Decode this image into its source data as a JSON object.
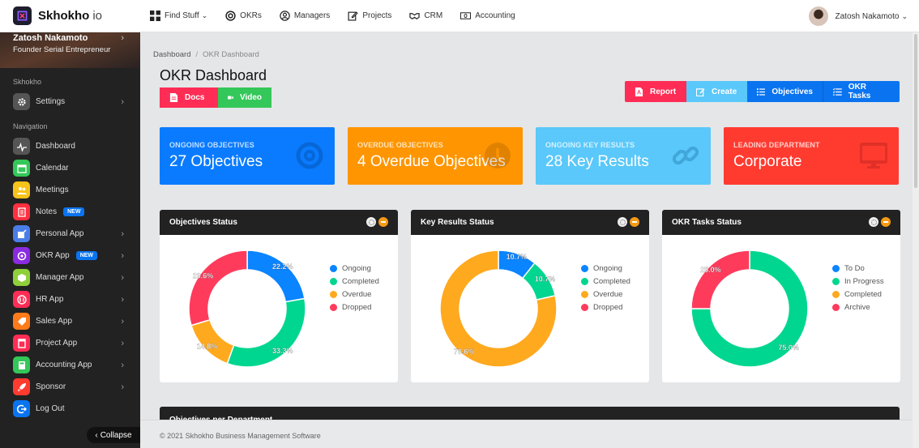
{
  "app": {
    "brand": "Skhokho",
    "brand_suffix": "io"
  },
  "topnav": [
    {
      "label": "Find Stuff",
      "icon": "grid-icon",
      "dropdown": true
    },
    {
      "label": "OKRs",
      "icon": "target-icon"
    },
    {
      "label": "Managers",
      "icon": "user-circle-icon"
    },
    {
      "label": "Projects",
      "icon": "edit-icon"
    },
    {
      "label": "CRM",
      "icon": "handshake-icon"
    },
    {
      "label": "Accounting",
      "icon": "money-icon"
    }
  ],
  "user": {
    "name": "Zatosh Nakamoto"
  },
  "sidebar": {
    "profile": {
      "name": "Zatosh Nakamoto",
      "role": "Founder Serial Entrepreneur"
    },
    "section1": "Skhokho",
    "settings": {
      "label": "Settings"
    },
    "section2": "Navigation",
    "items": [
      {
        "label": "Dashboard",
        "icon": "pulse-icon",
        "color": "#555555"
      },
      {
        "label": "Calendar",
        "icon": "calendar-icon",
        "color": "#34c759"
      },
      {
        "label": "Meetings",
        "icon": "people-icon",
        "color": "#f7c21a"
      },
      {
        "label": "Notes",
        "icon": "notes-icon",
        "color": "#ff3040",
        "badge": "NEW"
      },
      {
        "label": "Personal App",
        "icon": "pen-icon",
        "color": "#4a7de8",
        "chevron": true
      },
      {
        "label": "OKR App",
        "icon": "target-icon",
        "color": "#8a2be2",
        "badge": "NEW",
        "chevron": true
      },
      {
        "label": "Manager App",
        "icon": "box-icon",
        "color": "#8fcf3a",
        "chevron": true
      },
      {
        "label": "HR App",
        "icon": "hr-icon",
        "color": "#ff2d55",
        "chevron": true
      },
      {
        "label": "Sales App",
        "icon": "tag-icon",
        "color": "#ff7a1a",
        "chevron": true
      },
      {
        "label": "Project App",
        "icon": "project-icon",
        "color": "#ff2d55",
        "chevron": true
      },
      {
        "label": "Accounting App",
        "icon": "calculator-icon",
        "color": "#34c759",
        "chevron": true
      },
      {
        "label": "Sponsor",
        "icon": "rocket-icon",
        "color": "#ff3b30",
        "chevron": true
      },
      {
        "label": "Log Out",
        "icon": "logout-icon",
        "color": "#0a74f0"
      }
    ],
    "collapse_label": "Collapse"
  },
  "breadcrumb": {
    "root": "Dashboard",
    "current": "OKR Dashboard"
  },
  "page_title": "OKR Dashboard",
  "left_buttons": {
    "docs": "Docs",
    "video": "Video"
  },
  "toolbar": {
    "report": "Report",
    "create": "Create",
    "objectives": "Objectives",
    "okr_tasks": "OKR Tasks"
  },
  "cards": [
    {
      "label": "ONGOING OBJECTIVES",
      "value": "27 Objectives",
      "color": "#0a7bff",
      "icon": "target-icon"
    },
    {
      "label": "OVERDUE OBJECTIVES",
      "value": "4 Overdue Objectives",
      "color": "#ff9500",
      "icon": "clock-icon"
    },
    {
      "label": "ONGOING KEY RESULTS",
      "value": "28 Key Results",
      "color": "#5ac8fa",
      "icon": "link-icon"
    },
    {
      "label": "LEADING DEPARTMENT",
      "value": "Corporate",
      "color": "#ff3b30",
      "icon": "monitor-icon"
    }
  ],
  "chart_data": [
    {
      "type": "pie",
      "title": "Objectives Status",
      "categories": [
        "Ongoing",
        "Completed",
        "Overdue",
        "Dropped"
      ],
      "values": [
        22.2,
        33.3,
        14.8,
        29.6
      ],
      "colors": [
        "#0a84ff",
        "#00d68f",
        "#ffa91f",
        "#ff3b5c"
      ],
      "legend": "right"
    },
    {
      "type": "pie",
      "title": "Key Results Status",
      "categories": [
        "Ongoing",
        "Completed",
        "Overdue",
        "Dropped"
      ],
      "values": [
        10.7,
        10.7,
        78.6,
        0
      ],
      "colors": [
        "#0a84ff",
        "#00d68f",
        "#ffa91f",
        "#ff3b5c"
      ],
      "legend": "right"
    },
    {
      "type": "pie",
      "title": "OKR Tasks Status",
      "categories": [
        "To Do",
        "In Progress",
        "Completed",
        "Archive"
      ],
      "values": [
        0,
        75.0,
        0,
        25.0
      ],
      "colors": [
        "#0a84ff",
        "#00d68f",
        "#ffa91f",
        "#ff3b5c"
      ],
      "legend": "right"
    }
  ],
  "bottom_panel": {
    "title": "Objectives per Department"
  },
  "footer": "© 2021 Skhokho Business Management Software"
}
